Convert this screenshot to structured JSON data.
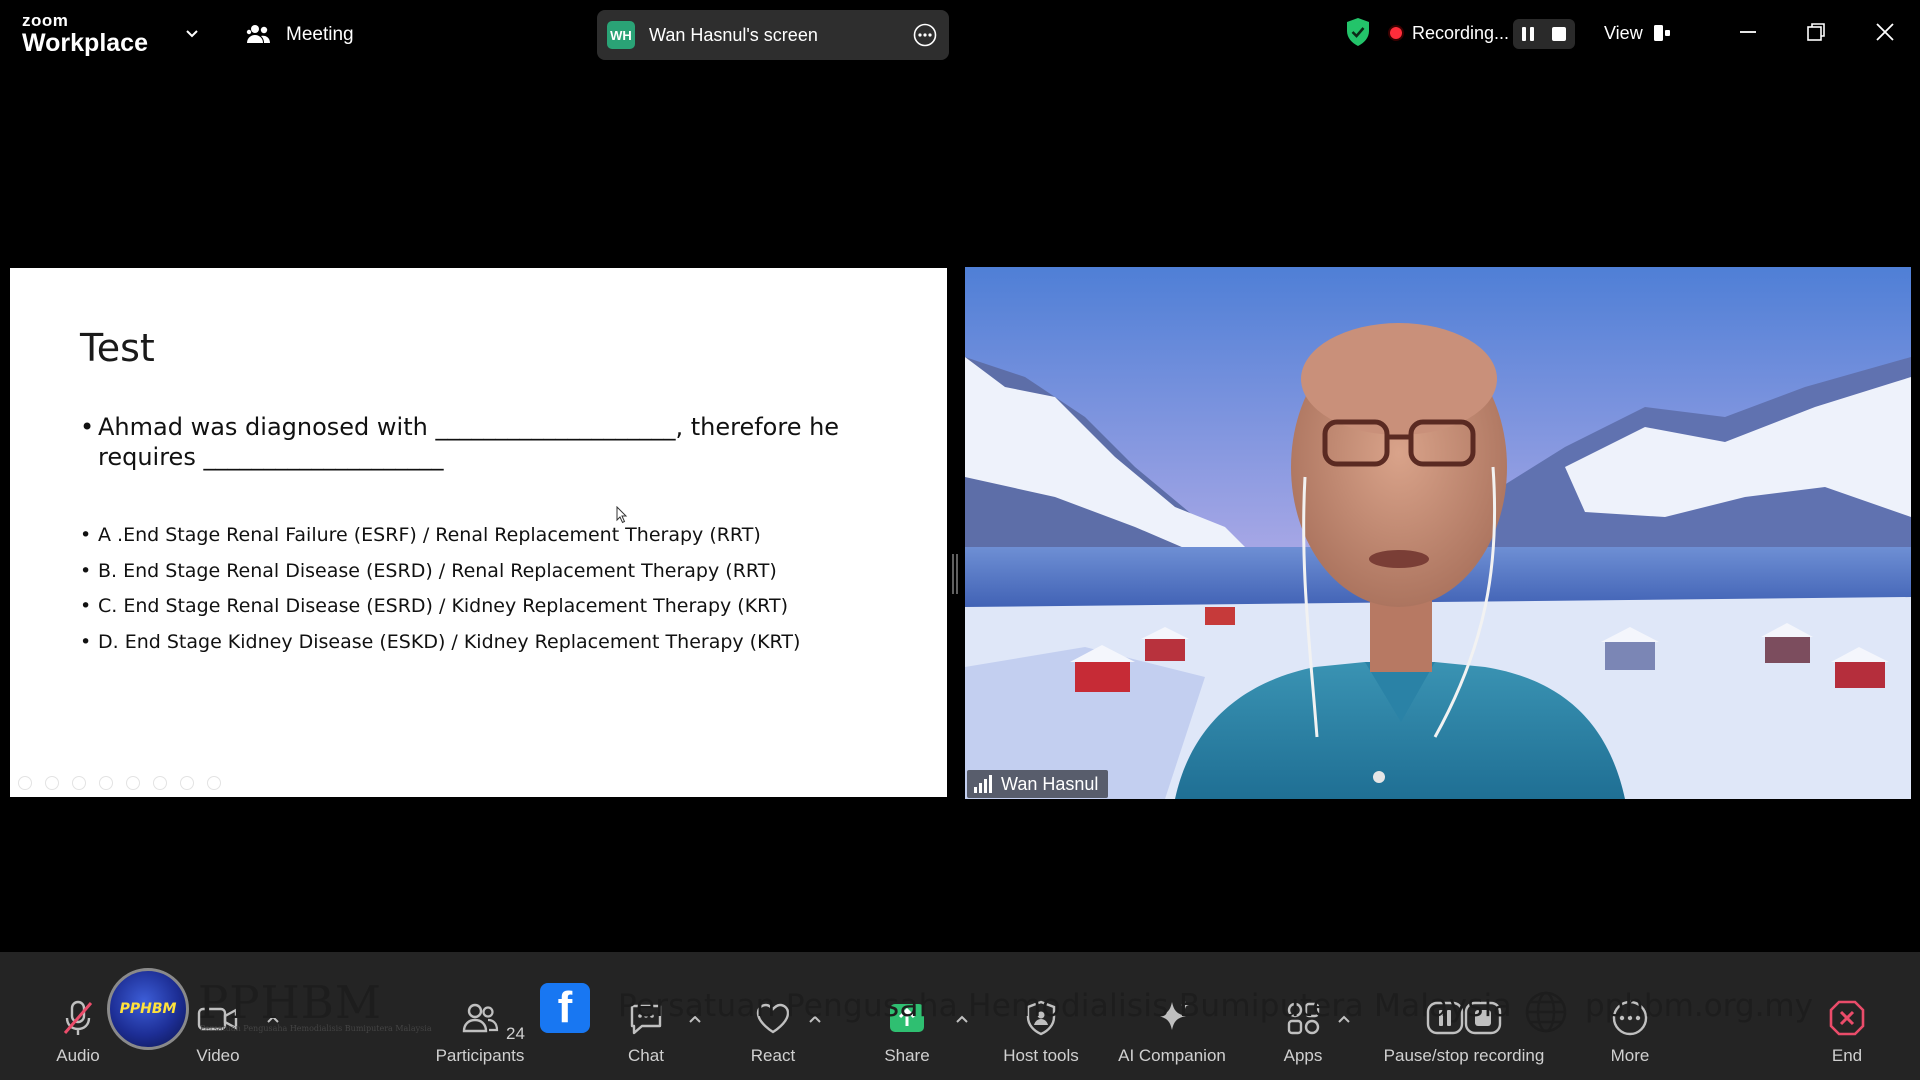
{
  "app": {
    "brand_top": "zoom",
    "brand_bottom": "Workplace",
    "meeting_label": "Meeting",
    "share_badge": "WH",
    "share_title": "Wan Hasnul's screen",
    "recording_label": "Recording...",
    "view_label": "View"
  },
  "slide": {
    "title": "Test",
    "question": "Ahmad was diagnosed with ____________________, therefore he requires ____________________",
    "options": [
      "A .End Stage Renal Failure (ESRF) / Renal Replacement Therapy (RRT)",
      "B. End Stage Renal Disease (ESRD) / Renal Replacement Therapy (RRT)",
      "C. End Stage Renal Disease (ESRD) / Kidney Replacement Therapy (KRT)",
      "D. End Stage Kidney Disease (ESKD) / Kidney Replacement Therapy (KRT)"
    ]
  },
  "participant": {
    "name": "Wan Hasnul"
  },
  "toolbar": {
    "audio": "Audio",
    "video": "Video",
    "participants": "Participants",
    "participants_count": "24",
    "chat": "Chat",
    "react": "React",
    "share": "Share",
    "host_tools": "Host tools",
    "ai_companion": "AI Companion",
    "apps": "Apps",
    "pause_stop": "Pause/stop recording",
    "more": "More",
    "end": "End"
  },
  "banner": {
    "logo_badge": "PPHBM",
    "logo_text": "PPHBM",
    "logo_subtext": "Persatuan Pengusaha Hemodialisis Bumiputera Malaysia",
    "facebook_glyph": "f",
    "org_name": "Persatuan Pengusaha Hemodialisis Bumiputera Malaysia",
    "url": "pphbm.org.my"
  },
  "colors": {
    "accent_green": "#2aa376",
    "recording_red": "#ff2d3a",
    "share_green": "#2fbf71",
    "end_red": "#ea4c6a",
    "facebook_blue": "#1877f2"
  }
}
